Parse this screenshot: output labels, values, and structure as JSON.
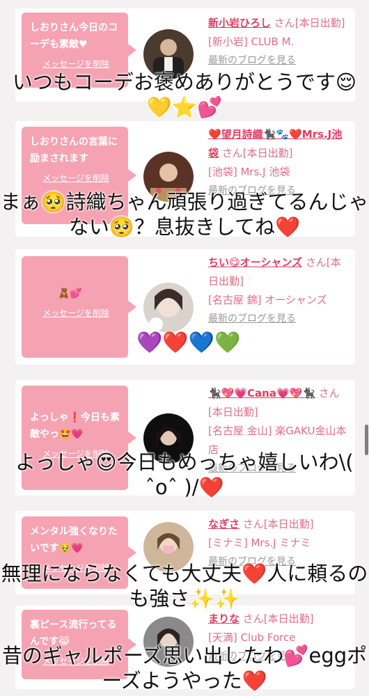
{
  "cards": [
    {
      "message": "しおりさん今日のコーデも素敵♥",
      "delete_label": "メッセージを削除",
      "name": "新小岩ひろし",
      "suffix": "さん[本日出勤]",
      "shop": "[新小岩] CLUB M.",
      "blog": "最新のブログを見る",
      "avatar_icon": "person-photo-icon"
    },
    {
      "message": "しおりさんの言葉に励まされます",
      "delete_label": "メッセージを削除",
      "name": "❤️望月詩織🐈‍⬛🐾❤️Mrs.J池袋",
      "suffix": "さん[本日出勤]",
      "shop": "[池袋] Mrs.J 池袋",
      "blog": "最新のブログを見る",
      "avatar_icon": "person-photo-icon"
    },
    {
      "message": "🧸💕",
      "delete_label": "メッセージを削除",
      "name": "ちい😋オーシャンズ",
      "suffix": "さん[本日出勤]",
      "shop": "[名古屋 錦] オーシャンズ",
      "blog": "最新のブログを見る",
      "avatar_icon": "person-photo-icon"
    },
    {
      "message": "よっしゃ❗今日も素敵やっ🤩💗",
      "delete_label": "メッセージを削除",
      "name": "🐈‍⬛💖💗Cana💗💖🐈‍⬛",
      "suffix": "さん[本日出勤]",
      "shop": "[名古屋 金山] 楽GAKU金山本店",
      "blog": "最新のブログを見る",
      "avatar_icon": "person-photo-icon"
    },
    {
      "message": "メンタル強くなりたいです🥹💗",
      "delete_label": "メッセージを削除",
      "name": "なぎさ",
      "suffix": "さん[本日出勤]",
      "shop": "[ミナミ] Mrs.J ミナミ",
      "blog": "最新のブログを見る",
      "avatar_icon": "person-photo-icon"
    },
    {
      "message": "裏ピース流行ってるんです😹",
      "delete_label": "メッセージを削除",
      "name": "まりな",
      "suffix": "さん[本日出勤]",
      "shop": "[天満] Club Force",
      "blog": "最新のブログを見る",
      "avatar_icon": "person-photo-icon"
    }
  ],
  "overlays": {
    "o1": "いつもコーデお褒めありがとうです😌💛⭐💕",
    "o2": "まぁ🥺詩織ちゃん頑張り過ぎてるんじゃない🥺？息抜きしてね❤️",
    "o3": "💜❤️💙💚",
    "o4": "よっしゃ😍今日もめっちゃ嬉しいわ\\( ˆoˆ )/❤️",
    "o5": "無理にならなくても大丈夫❤️人に頼るのも強さ✨✨",
    "o6": "昔のギャルポーズ思い出したわ💕eggポーズようやった❤️"
  }
}
